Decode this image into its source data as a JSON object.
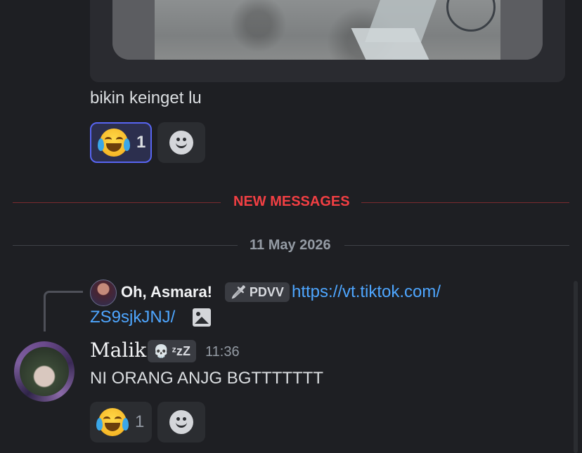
{
  "embed": {
    "image_alt_icon": "photo-thumbnail"
  },
  "message1": {
    "text": "bikin keinget lu",
    "reactions": [
      {
        "emoji": "😂",
        "count": "1",
        "active": true
      }
    ]
  },
  "new_messages_divider": {
    "label": "NEW MESSAGES",
    "color": "#f23f43"
  },
  "date_divider": {
    "label": "11 May 2026"
  },
  "reply": {
    "author": "Oh, Asmara!",
    "tag_icon": "🗡",
    "tag": "PDVV",
    "link_line1": "https://vt.tiktok.com/",
    "link_line2": "ZS9sjkJNJ/",
    "attachment_icon": "image-icon"
  },
  "message2": {
    "author": "Malik",
    "tag_icon": "💀",
    "tag": "ᶻz",
    "tag_suffix": "Z",
    "timestamp": "11:36",
    "text": "NI ORANG ANJG BGTTTTTTT",
    "reactions": [
      {
        "emoji": "😂",
        "count": "1",
        "active": false
      }
    ]
  },
  "colors": {
    "background": "#1e1f23",
    "accent": "#5865f2",
    "link": "#4ea6ff",
    "new_messages": "#f23f43"
  }
}
